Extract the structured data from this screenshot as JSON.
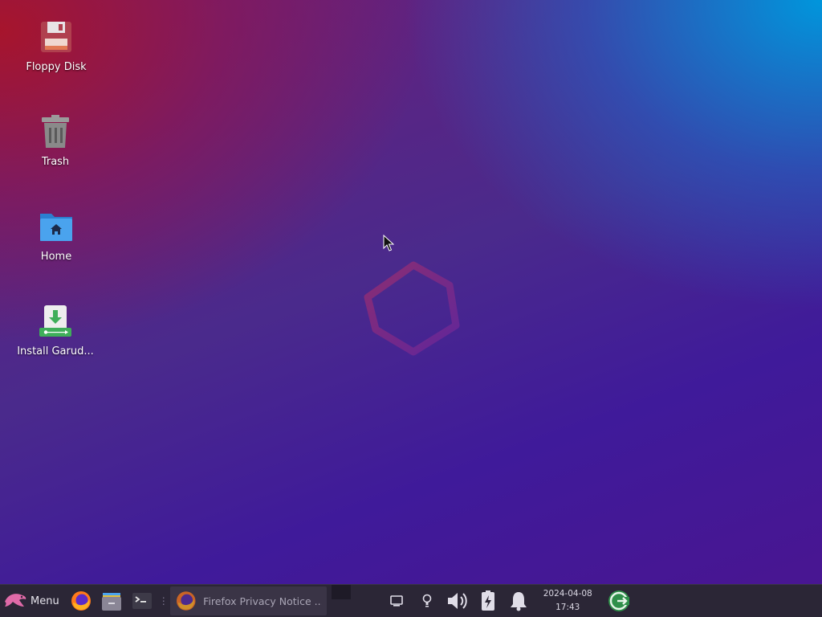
{
  "desktop": {
    "icons": [
      {
        "label": "Floppy Disk",
        "icon": "floppy-disk-icon"
      },
      {
        "label": "Trash",
        "icon": "trash-icon"
      },
      {
        "label": "Home",
        "icon": "home-folder-icon"
      },
      {
        "label": "Install Garud...",
        "icon": "installer-icon"
      }
    ],
    "watermark_icon": "garuda-logo-watermark"
  },
  "taskbar": {
    "menu_label": "Menu",
    "menu_icon": "garuda-eagle-icon",
    "launchers": [
      {
        "icon": "firefox-icon"
      },
      {
        "icon": "file-manager-icon"
      },
      {
        "icon": "terminal-icon"
      }
    ],
    "tasks": [
      {
        "label": "Firefox Privacy Notice ...",
        "icon": "firefox-icon"
      }
    ],
    "tray": [
      {
        "icon": "screen-icon"
      },
      {
        "icon": "lightbulb-icon"
      },
      {
        "icon": "volume-icon"
      },
      {
        "icon": "battery-charging-icon"
      },
      {
        "icon": "notification-bell-icon"
      }
    ],
    "clock": {
      "date": "2024-04-08",
      "time": "17:43"
    },
    "logout_icon": "logout-icon"
  },
  "colors": {
    "taskbar_bg": "#2b2636",
    "accent_green": "#3fae5a"
  }
}
